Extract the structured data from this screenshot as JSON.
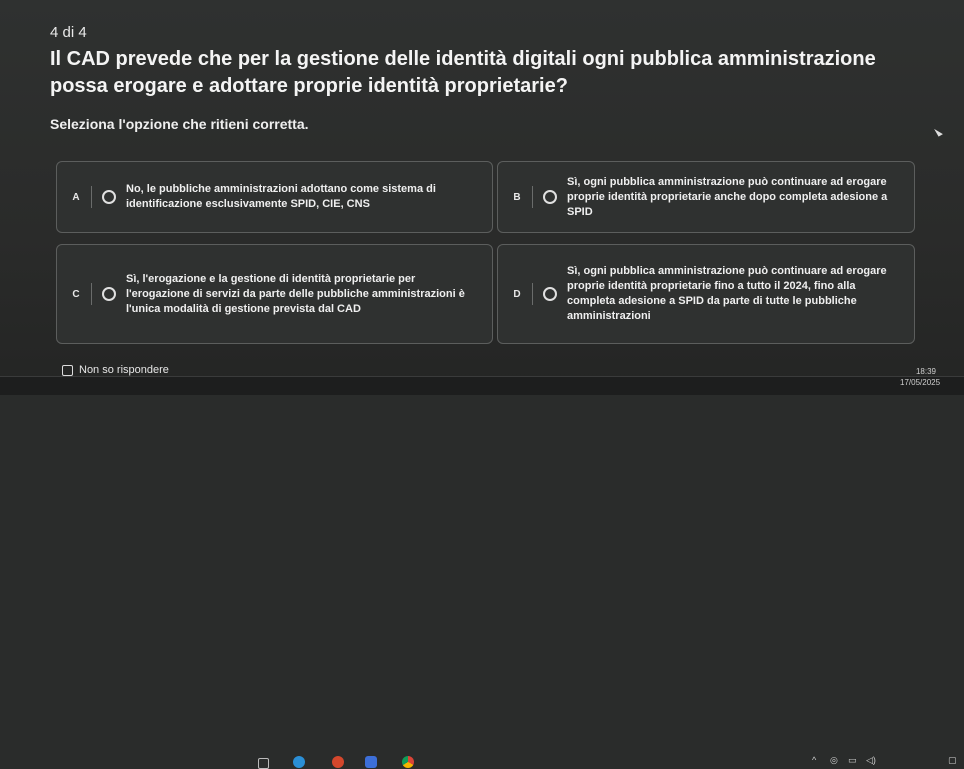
{
  "quiz": {
    "counter": "4 di 4",
    "question": "Il CAD prevede che per la gestione delle identità digitali ogni pubblica amministrazione possa erogare e adottare proprie identità proprietarie?",
    "instruction": "Seleziona l'opzione che ritieni corretta.",
    "options": [
      {
        "letter": "A",
        "text": "No, le pubbliche amministrazioni adottano come sistema di identificazione esclusivamente SPID, CIE, CNS"
      },
      {
        "letter": "B",
        "text": "Sì, ogni pubblica amministrazione può continuare ad erogare proprie identità proprietarie anche dopo completa adesione a SPID"
      },
      {
        "letter": "C",
        "text": "Sì, l'erogazione e la gestione di identità proprietarie per l'erogazione di servizi da parte delle pubbliche amministrazioni è l'unica modalità di gestione prevista dal CAD"
      },
      {
        "letter": "D",
        "text": "Sì, ogni pubblica amministrazione può continuare ad erogare proprie identità proprietarie fino a tutto il 2024, fino alla completa adesione a SPID da parte di tutte le pubbliche amministrazioni"
      }
    ],
    "no_answer_label": "Non so rispondere"
  },
  "taskbar": {
    "time": "18:39",
    "date": "17/05/2025"
  }
}
